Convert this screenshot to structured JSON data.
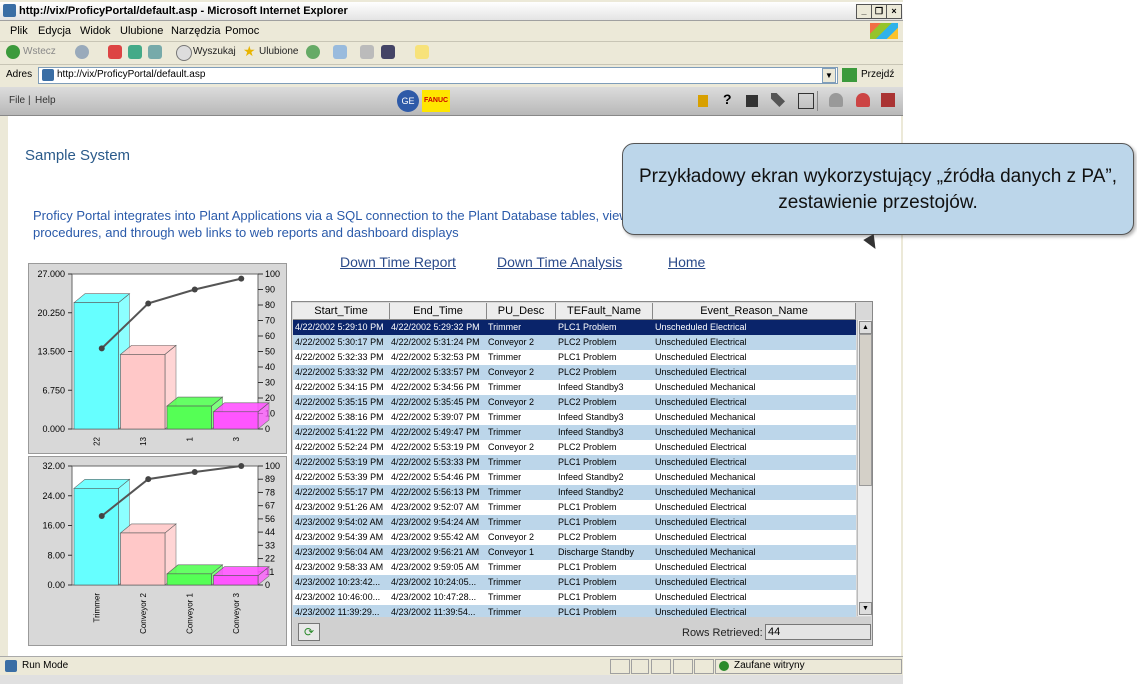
{
  "window": {
    "title": "http://vix/ProficyPortal/default.asp - Microsoft Internet Explorer",
    "buttons": [
      "_",
      "❐",
      "×"
    ]
  },
  "menu": [
    "Plik",
    "Edycja",
    "Widok",
    "Ulubione",
    "Narzędzia",
    "Pomoc"
  ],
  "toolbar": {
    "back": "Wstecz",
    "search": "Wyszukaj",
    "favorites": "Ulubione"
  },
  "address": {
    "label": "Adres",
    "url": "http://vix/ProficyPortal/default.asp",
    "go": "Przejdź"
  },
  "portal": {
    "file": "File",
    "help": "Help",
    "logo_right": "FANUC",
    "logo_left": "GE"
  },
  "page": {
    "title": "Sample System",
    "intro": "Proficy Portal integrates into Plant Applications via a SQL connection to the Plant Database tables, views and stored procedures, and through web links to web reports and dashboard displays",
    "links": [
      "Down Time Report",
      "Down Time Analysis",
      "Home"
    ]
  },
  "callout": "Przykładowy ekran wykorzystujący „źródła danych z PA”, zestawienie przestojów.",
  "chart_data": [
    {
      "type": "bar",
      "categories": [
        "22",
        "13",
        "1",
        "3"
      ],
      "values": [
        22,
        13,
        4,
        3
      ],
      "cumulative_percent": [
        52,
        81,
        90,
        97
      ],
      "yticks_left": [
        "27.000",
        "20.250",
        "13.500",
        "6.750",
        "0.000"
      ],
      "ylim": [
        0,
        27
      ],
      "yticks_right": [
        "100",
        "90",
        "80",
        "70",
        "60",
        "50",
        "40",
        "30",
        "20",
        "10",
        "0"
      ],
      "colors": [
        "#66ffff",
        "#ffc8c8",
        "#55ff55",
        "#ff55ff"
      ]
    },
    {
      "type": "bar",
      "categories": [
        "Trimmer",
        "Conveyor 2",
        "Conveyor 1",
        "Conveyor 3"
      ],
      "values": [
        26,
        14,
        3,
        2.5
      ],
      "cumulative_percent": [
        58,
        89,
        95,
        100
      ],
      "yticks_left": [
        "32.00",
        "24.00",
        "16.00",
        "8.00",
        "0.00"
      ],
      "ylim": [
        0,
        32
      ],
      "yticks_right": [
        "100",
        "89",
        "78",
        "67",
        "56",
        "44",
        "33",
        "22",
        "11",
        "0"
      ],
      "colors": [
        "#66ffff",
        "#ffc8c8",
        "#55ff55",
        "#ff55ff"
      ]
    }
  ],
  "grid": {
    "columns": [
      "Start_Time",
      "End_Time",
      "PU_Desc",
      "TEFault_Name",
      "Event_Reason_Name"
    ],
    "rows": [
      [
        "4/22/2002 5:29:10 PM",
        "4/22/2002 5:29:32 PM",
        "Trimmer",
        "PLC1 Problem",
        "Unscheduled Electrical"
      ],
      [
        "4/22/2002 5:30:17 PM",
        "4/22/2002 5:31:24 PM",
        "Conveyor 2",
        "PLC2 Problem",
        "Unscheduled Electrical"
      ],
      [
        "4/22/2002 5:32:33 PM",
        "4/22/2002 5:32:53 PM",
        "Trimmer",
        "PLC1 Problem",
        "Unscheduled Electrical"
      ],
      [
        "4/22/2002 5:33:32 PM",
        "4/22/2002 5:33:57 PM",
        "Conveyor 2",
        "PLC2 Problem",
        "Unscheduled Electrical"
      ],
      [
        "4/22/2002 5:34:15 PM",
        "4/22/2002 5:34:56 PM",
        "Trimmer",
        "Infeed Standby3",
        "Unscheduled Mechanical"
      ],
      [
        "4/22/2002 5:35:15 PM",
        "4/22/2002 5:35:45 PM",
        "Conveyor 2",
        "PLC2 Problem",
        "Unscheduled Electrical"
      ],
      [
        "4/22/2002 5:38:16 PM",
        "4/22/2002 5:39:07 PM",
        "Trimmer",
        "Infeed Standby3",
        "Unscheduled Mechanical"
      ],
      [
        "4/22/2002 5:41:22 PM",
        "4/22/2002 5:49:47 PM",
        "Trimmer",
        "Infeed Standby3",
        "Unscheduled Mechanical"
      ],
      [
        "4/22/2002 5:52:24 PM",
        "4/22/2002 5:53:19 PM",
        "Conveyor 2",
        "PLC2 Problem",
        "Unscheduled Electrical"
      ],
      [
        "4/22/2002 5:53:19 PM",
        "4/22/2002 5:53:33 PM",
        "Trimmer",
        "PLC1 Problem",
        "Unscheduled Electrical"
      ],
      [
        "4/22/2002 5:53:39 PM",
        "4/22/2002 5:54:46 PM",
        "Trimmer",
        "Infeed Standby2",
        "Unscheduled Mechanical"
      ],
      [
        "4/22/2002 5:55:17 PM",
        "4/22/2002 5:56:13 PM",
        "Trimmer",
        "Infeed Standby2",
        "Unscheduled Mechanical"
      ],
      [
        "4/23/2002 9:51:26 AM",
        "4/23/2002 9:52:07 AM",
        "Trimmer",
        "PLC1 Problem",
        "Unscheduled Electrical"
      ],
      [
        "4/23/2002 9:54:02 AM",
        "4/23/2002 9:54:24 AM",
        "Trimmer",
        "PLC1 Problem",
        "Unscheduled Electrical"
      ],
      [
        "4/23/2002 9:54:39 AM",
        "4/23/2002 9:55:42 AM",
        "Conveyor 2",
        "PLC2 Problem",
        "Unscheduled Electrical"
      ],
      [
        "4/23/2002 9:56:04 AM",
        "4/23/2002 9:56:21 AM",
        "Conveyor 1",
        "Discharge Standby",
        "Unscheduled Mechanical"
      ],
      [
        "4/23/2002 9:58:33 AM",
        "4/23/2002 9:59:05 AM",
        "Trimmer",
        "PLC1 Problem",
        "Unscheduled Electrical"
      ],
      [
        "4/23/2002 10:23:42...",
        "4/23/2002 10:24:05...",
        "Trimmer",
        "PLC1 Problem",
        "Unscheduled Electrical"
      ],
      [
        "4/23/2002 10:46:00...",
        "4/23/2002 10:47:28...",
        "Trimmer",
        "PLC1 Problem",
        "Unscheduled Electrical"
      ],
      [
        "4/23/2002 11:39:29...",
        "4/23/2002 11:39:54...",
        "Trimmer",
        "PLC1 Problem",
        "Unscheduled Electrical"
      ]
    ],
    "selected_row": 0,
    "rows_label": "Rows Retrieved:",
    "rows_value": "44"
  },
  "status": {
    "left": "Run Mode",
    "right": "Zaufane witryny"
  },
  "colors": {
    "link": "#2a4a8a",
    "selected_row": "#0a246a",
    "alt_row": "#bcd6ea"
  }
}
